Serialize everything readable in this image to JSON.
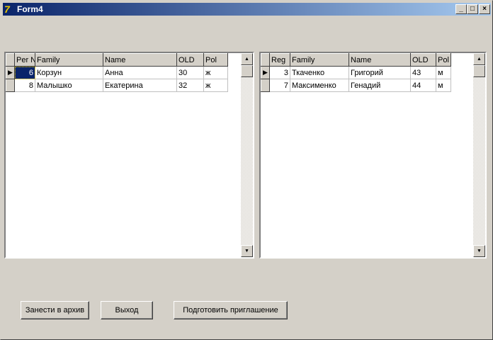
{
  "window": {
    "title": "Form4",
    "icon": "delphi-app-icon",
    "controls": [
      "minimize",
      "maximize",
      "close"
    ]
  },
  "grid_left": {
    "columns": [
      "Per N",
      "Family",
      "Name",
      "OLD",
      "Pol"
    ],
    "rows": [
      [
        "6",
        "Корзун",
        "Анна",
        "30",
        "ж"
      ],
      [
        "8",
        "Малышко",
        "Екатерина",
        "32",
        "ж"
      ]
    ],
    "selected_row": 0
  },
  "grid_right": {
    "columns": [
      "Reg",
      "Family",
      "Name",
      "OLD",
      "Pol"
    ],
    "rows": [
      [
        "3",
        "Ткаченко",
        "Григорий",
        "43",
        "м"
      ],
      [
        "7",
        "Максименко",
        "Генадий",
        "44",
        "м"
      ]
    ],
    "selected_row": 0
  },
  "buttons": {
    "archive": "Занести в архив",
    "exit": "Выход",
    "invite": "Подготовить приглашение"
  }
}
